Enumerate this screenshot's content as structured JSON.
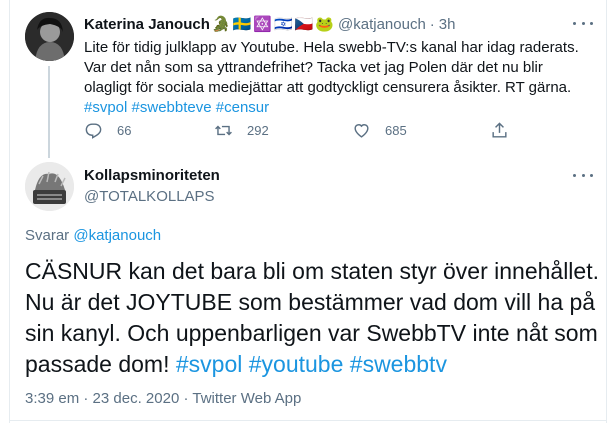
{
  "tweet1": {
    "name": "Katerina Janouch",
    "name_emojis": [
      "🐊",
      "🇸🇪",
      "🔯",
      "🇮🇱",
      "🇨🇿",
      "🐸"
    ],
    "handle": "@katjanouch",
    "separator": "·",
    "time": "3h",
    "text_plain": "Lite för tidig julklapp av Youtube. Hela swebb-TV:s kanal har idag raderats. Var det nån som sa yttrandefrihet? Tacka vet jag Polen där det nu blir olagligt för sociala mediejättar att godtyckligt censurera åsikter. RT gärna.",
    "hashtags": [
      "#svpol",
      "#swebbteve",
      "#censur"
    ],
    "actions": {
      "replies": "66",
      "retweets": "292",
      "likes": "685"
    }
  },
  "tweet2": {
    "name": "Kollapsminoriteten",
    "handle": "@TOTALKOLLAPS",
    "replying_prefix": "Svarar",
    "replying_to": "@katjanouch",
    "text_plain": "CÄSNUR kan det bara bli om staten styr över innehållet. Nu är det JOYTUBE som bestämmer vad dom vill ha på sin kanyl. Och uppenbarligen var SwebbTV inte nåt som passade dom!",
    "hashtags": [
      "#svpol",
      "#youtube",
      "#swebbtv"
    ],
    "time": "3:39 em",
    "separator": "·",
    "date": "23 dec. 2020",
    "source": "Twitter Web App"
  },
  "colors": {
    "link": "#1b95e0",
    "muted": "#5b7083",
    "text": "#0f1419",
    "border": "#e6ecf0"
  },
  "icons": {
    "reply": "reply-icon",
    "retweet": "retweet-icon",
    "like": "heart-icon",
    "share": "share-icon",
    "more": "more-icon"
  }
}
